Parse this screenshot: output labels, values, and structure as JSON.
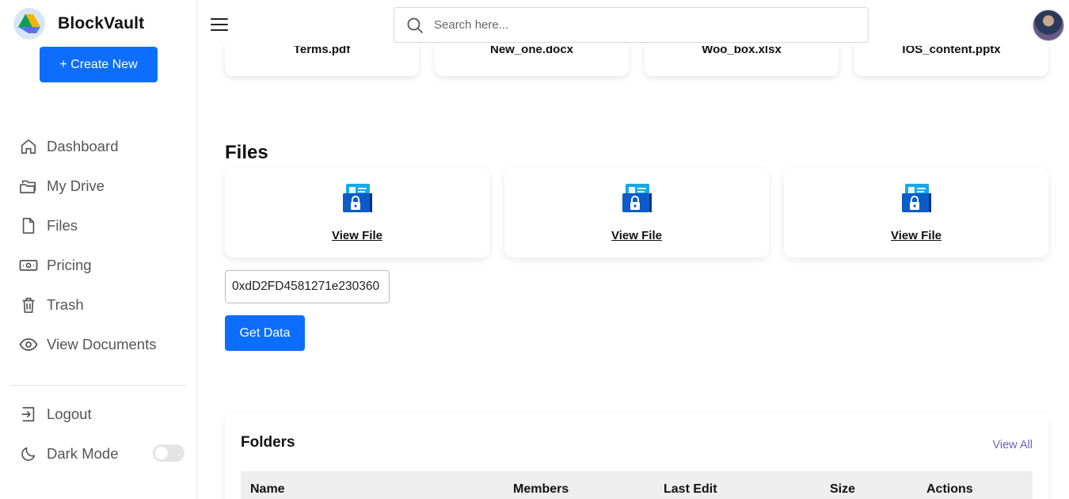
{
  "brand": {
    "name": "BlockVault",
    "logo_icon": "drive-triangle-logo"
  },
  "sidebar": {
    "create_label": "+ Create New",
    "items": [
      {
        "label": "Dashboard",
        "icon": "home-icon"
      },
      {
        "label": "My Drive",
        "icon": "folders-icon"
      },
      {
        "label": "Files",
        "icon": "file-icon"
      },
      {
        "label": "Pricing",
        "icon": "money-icon"
      },
      {
        "label": "Trash",
        "icon": "trash-icon"
      },
      {
        "label": "View Documents",
        "icon": "eye-icon"
      }
    ],
    "logout_label": "Logout",
    "dark_mode_label": "Dark Mode",
    "dark_mode_on": false
  },
  "search": {
    "placeholder": "Search here..."
  },
  "recent_files": [
    {
      "name": "Terms.pdf"
    },
    {
      "name": "New_one.docx"
    },
    {
      "name": "Woo_box.xlsx"
    },
    {
      "name": "IOS_content.pptx"
    }
  ],
  "files": {
    "title": "Files",
    "cards": [
      {
        "link_label": "View File"
      },
      {
        "link_label": "View File"
      },
      {
        "link_label": "View File"
      }
    ],
    "address_value": "0xdD2FD4581271e230360",
    "get_data_label": "Get Data"
  },
  "folders": {
    "title": "Folders",
    "view_all_label": "View All",
    "columns": [
      "Name",
      "Members",
      "Last Edit",
      "Size",
      "Actions"
    ]
  },
  "colors": {
    "primary": "#0d6efd",
    "view_all": "#6c63c4"
  }
}
